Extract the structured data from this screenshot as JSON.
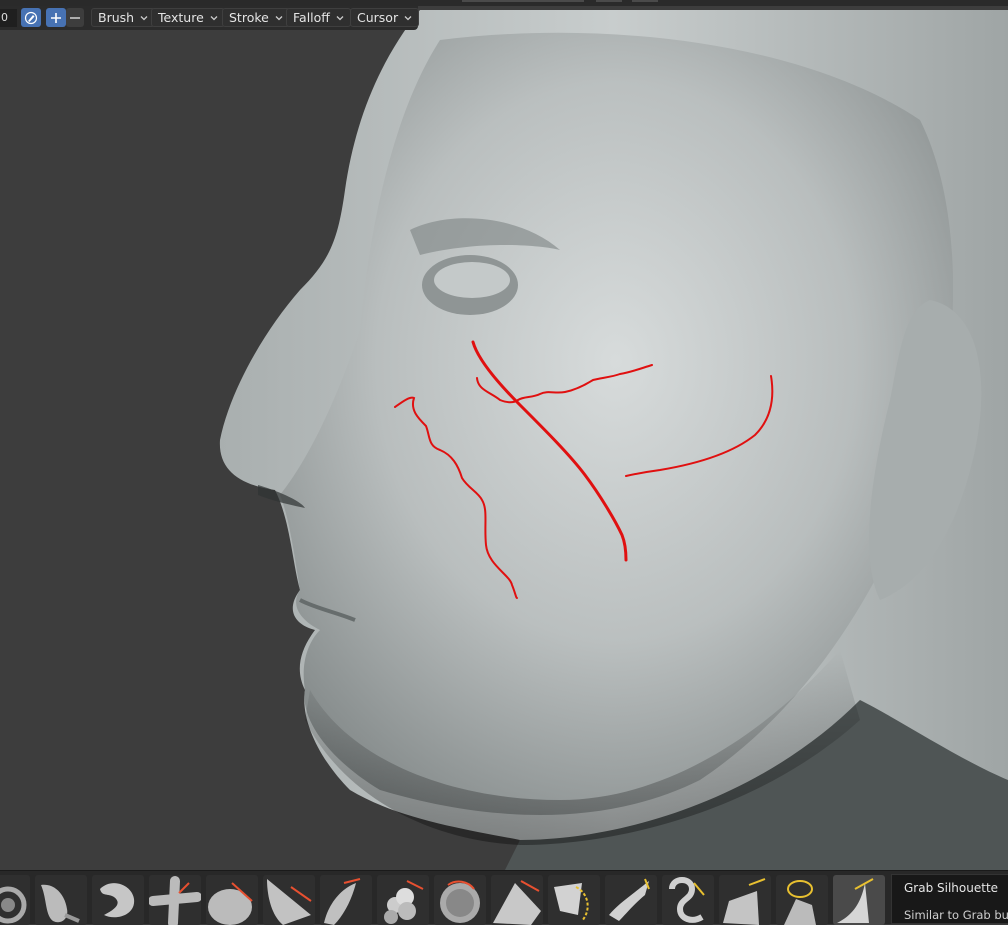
{
  "header": {
    "value_field": "0",
    "dropdowns": [
      {
        "label": "Brush"
      },
      {
        "label": "Texture"
      },
      {
        "label": "Stroke"
      },
      {
        "label": "Falloff"
      },
      {
        "label": "Cursor"
      }
    ],
    "icons": {
      "pen": "pen-pressure-icon",
      "add": "+",
      "subtract": "−"
    }
  },
  "viewport": {
    "subject": "sculpted head mesh",
    "annotation_color": "#e01010",
    "background_color": "#3d3d3d"
  },
  "brush_shelf": {
    "brushes": [
      "clay-strips",
      "smooth",
      "draw-sharp",
      "pinch",
      "flatten",
      "scrape",
      "crease",
      "blob",
      "multires-displacement",
      "layer",
      "fill",
      "snake-hook",
      "elastic-deform",
      "thumb",
      "pose",
      "rotate",
      "grab-silhouette"
    ],
    "active": "grab-silhouette"
  },
  "tooltip": {
    "title": "Grab Silhouette",
    "description": "Similar to Grab but o"
  },
  "colors": {
    "accent_blue": "#4772b3",
    "header_bg": "#2b2b2b",
    "brush_highlight": "#e85030"
  }
}
